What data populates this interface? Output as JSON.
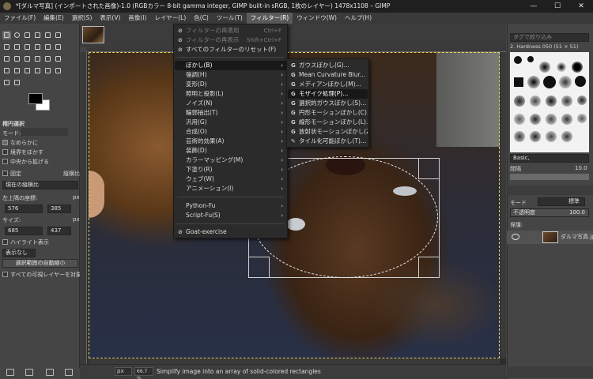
{
  "window": {
    "title": "*[ダルマ写真] (インポートされた画像)-1.0 (RGBカラー 8-bit gamma integer, GIMP built-in sRGB, 1枚のレイヤー) 1478x1108 – GIMP",
    "minimize": "—",
    "maximize": "☐",
    "close": "✕"
  },
  "menubar": [
    "ファイル(F)",
    "編集(E)",
    "選択(S)",
    "表示(V)",
    "画像(I)",
    "レイヤー(L)",
    "色(C)",
    "ツール(T)",
    "フィルター(R)",
    "ウィンドウ(W)",
    "ヘルプ(H)"
  ],
  "filter_menu": {
    "top_items": [
      {
        "label": "フィルターの再適用",
        "accel": "Ctrl+F"
      },
      {
        "label": "フィルターの再表示",
        "accel": "Shift+Ctrl+F"
      },
      {
        "label": "すべてのフィルターのリセット(F)",
        "accel": ""
      }
    ],
    "groups": [
      "ぼかし(B)",
      "強調(H)",
      "変形(D)",
      "照明と投影(L)",
      "ノイズ(N)",
      "輪郭抽出(T)",
      "汎用(G)",
      "合成(O)",
      "芸術的効果(A)",
      "装飾(D)",
      "カラーマッピング(M)",
      "下塗り(R)",
      "ウェブ(W)",
      "アニメーション(I)"
    ],
    "script_groups": [
      "Python-Fu",
      "Script-Fu(S)"
    ],
    "goat": "Goat-exercise"
  },
  "blur_menu": [
    "ガウスぼかし(G)...",
    "Mean Curvature Blur...",
    "メディアンぼかし(M)...",
    "モザイク処理(P)...",
    "選択的ガウスぼかし(S)...",
    "円形モーションぼかし(C)...",
    "線形モーションぼかし(L)...",
    "放射状モーションぼかし(Z)...",
    "タイル化可能ぼかし(T)..."
  ],
  "tool_options": {
    "title": "楕円選択",
    "mode_label": "モード:",
    "antialias": "なめらかに",
    "feather": "境界をぼかす",
    "expand": "中央から拡げる",
    "fixed": "固定",
    "aspect": "縦横比",
    "current": "現在の縦横比",
    "position_label": "左上隅の座標:",
    "pos_x": "576",
    "pos_y": "385",
    "pos_unit": "px",
    "size_label": "サイズ:",
    "size_w": "685",
    "size_h": "437",
    "size_unit": "px",
    "highlight": "ハイライト表示",
    "guides": "表示なし",
    "auto_shrink": "選択範囲の自動縮小",
    "shrink_merged": "すべての可視レイヤーを対象に"
  },
  "statusbar": {
    "unit": "px",
    "zoom": "66.7 %",
    "message": "Simplify image into an array of solid-colored rectangles"
  },
  "right_dock": {
    "filter_placeholder": "タグで絞り込み",
    "brush_name": "2. Hardness 050 (51 × 51)",
    "preset": "Basic,",
    "spacing_label": "間隔",
    "spacing_value": "10.0",
    "layers_tab_mode": "モード",
    "layers_mode_value": "標準",
    "opacity_label": "不透明度",
    "opacity_value": "100.0",
    "lock_label": "保護:",
    "layer_name": "ダルマ写真.jpg"
  }
}
